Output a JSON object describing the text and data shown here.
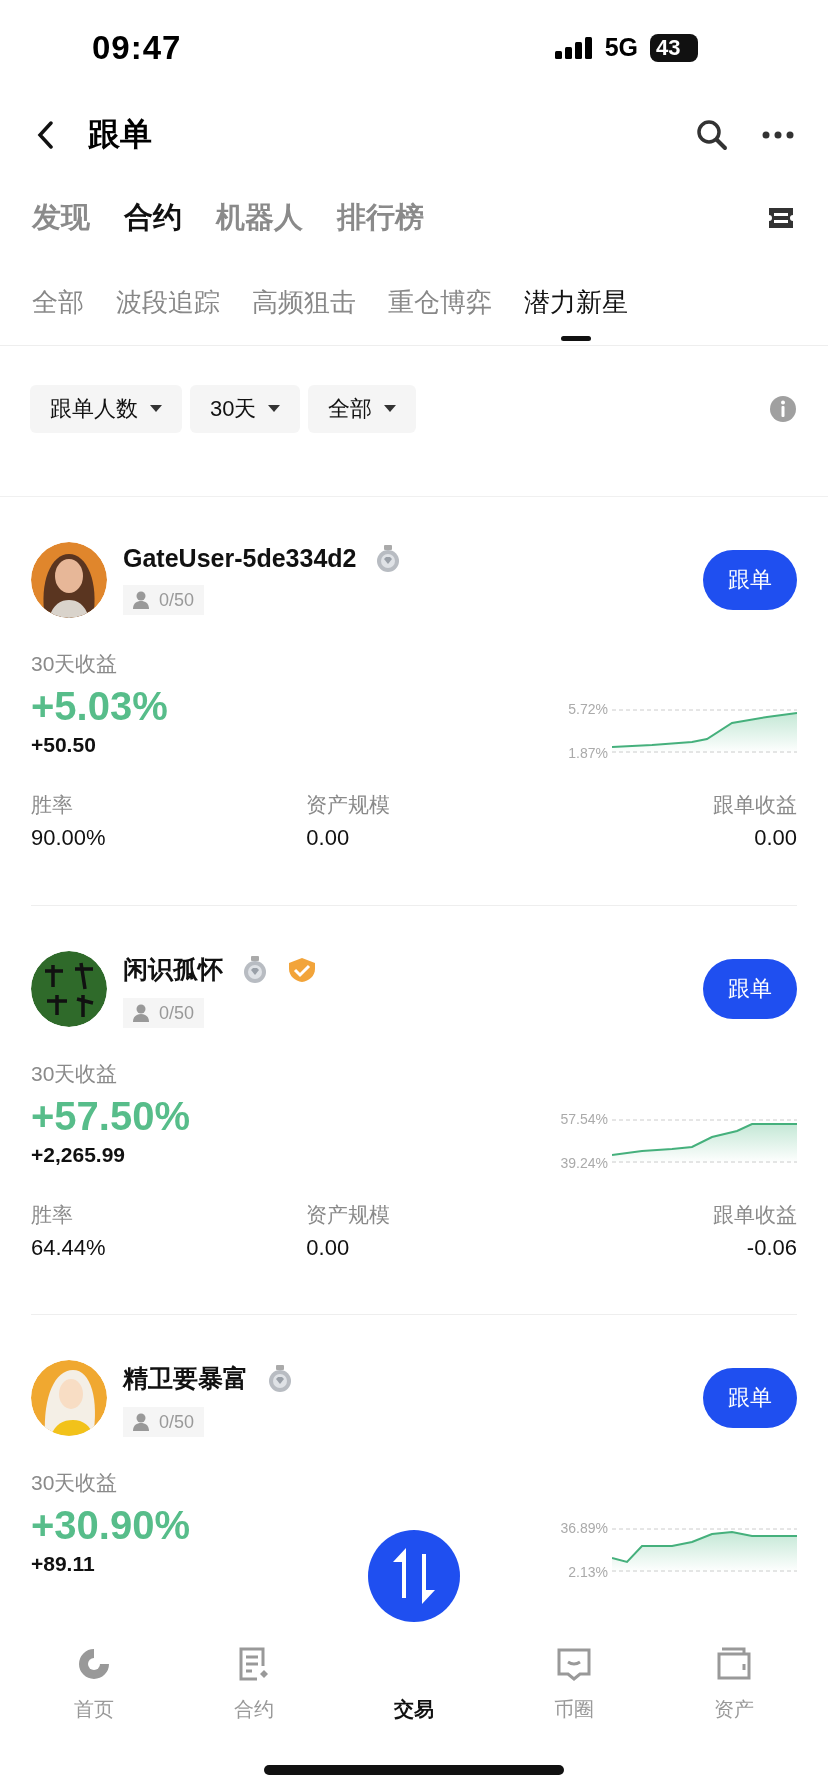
{
  "status_bar": {
    "time": "09:47",
    "network": "5G",
    "battery": "43"
  },
  "header": {
    "title": "跟单"
  },
  "main_tabs": [
    {
      "label": "发现",
      "selected": false
    },
    {
      "label": "合约",
      "selected": true
    },
    {
      "label": "机器人",
      "selected": false
    },
    {
      "label": "排行榜",
      "selected": false
    }
  ],
  "sub_tabs": [
    {
      "label": "全部",
      "selected": false
    },
    {
      "label": "波段追踪",
      "selected": false
    },
    {
      "label": "高频狙击",
      "selected": false
    },
    {
      "label": "重仓博弈",
      "selected": false
    },
    {
      "label": "潜力新星",
      "selected": true
    }
  ],
  "filters": [
    {
      "label": "跟单人数"
    },
    {
      "label": "30天"
    },
    {
      "label": "全部"
    }
  ],
  "traders": [
    {
      "name": "GateUser-5de334d2",
      "verified": false,
      "followers": "0/50",
      "button": "跟单",
      "period_label": "30天收益",
      "return_pct": "+5.03%",
      "return_amount": "+50.50",
      "chart_max": "5.72%",
      "chart_min": "1.87%",
      "stats": [
        {
          "label": "胜率",
          "value": "90.00%"
        },
        {
          "label": "资产规模",
          "value": "0.00"
        },
        {
          "label": "跟单收益",
          "value": "0.00"
        }
      ]
    },
    {
      "name": "闲识孤怀",
      "verified": true,
      "followers": "0/50",
      "button": "跟单",
      "period_label": "30天收益",
      "return_pct": "+57.50%",
      "return_amount": "+2,265.99",
      "chart_max": "57.54%",
      "chart_min": "39.24%",
      "stats": [
        {
          "label": "胜率",
          "value": "64.44%"
        },
        {
          "label": "资产规模",
          "value": "0.00"
        },
        {
          "label": "跟单收益",
          "value": "-0.06"
        }
      ]
    },
    {
      "name": "精卫要暴富",
      "verified": false,
      "followers": "0/50",
      "button": "跟单",
      "period_label": "30天收益",
      "return_pct": "+30.90%",
      "return_amount": "+89.11",
      "chart_max": "36.89%",
      "chart_min": "2.13%"
    }
  ],
  "bottom_nav": [
    {
      "label": "首页",
      "kind": "tab",
      "selected": false
    },
    {
      "label": "合约",
      "kind": "tab",
      "selected": false
    },
    {
      "label": "交易",
      "kind": "fab",
      "selected": true
    },
    {
      "label": "币圈",
      "kind": "tab",
      "selected": false
    },
    {
      "label": "资产",
      "kind": "tab",
      "selected": false
    }
  ]
}
